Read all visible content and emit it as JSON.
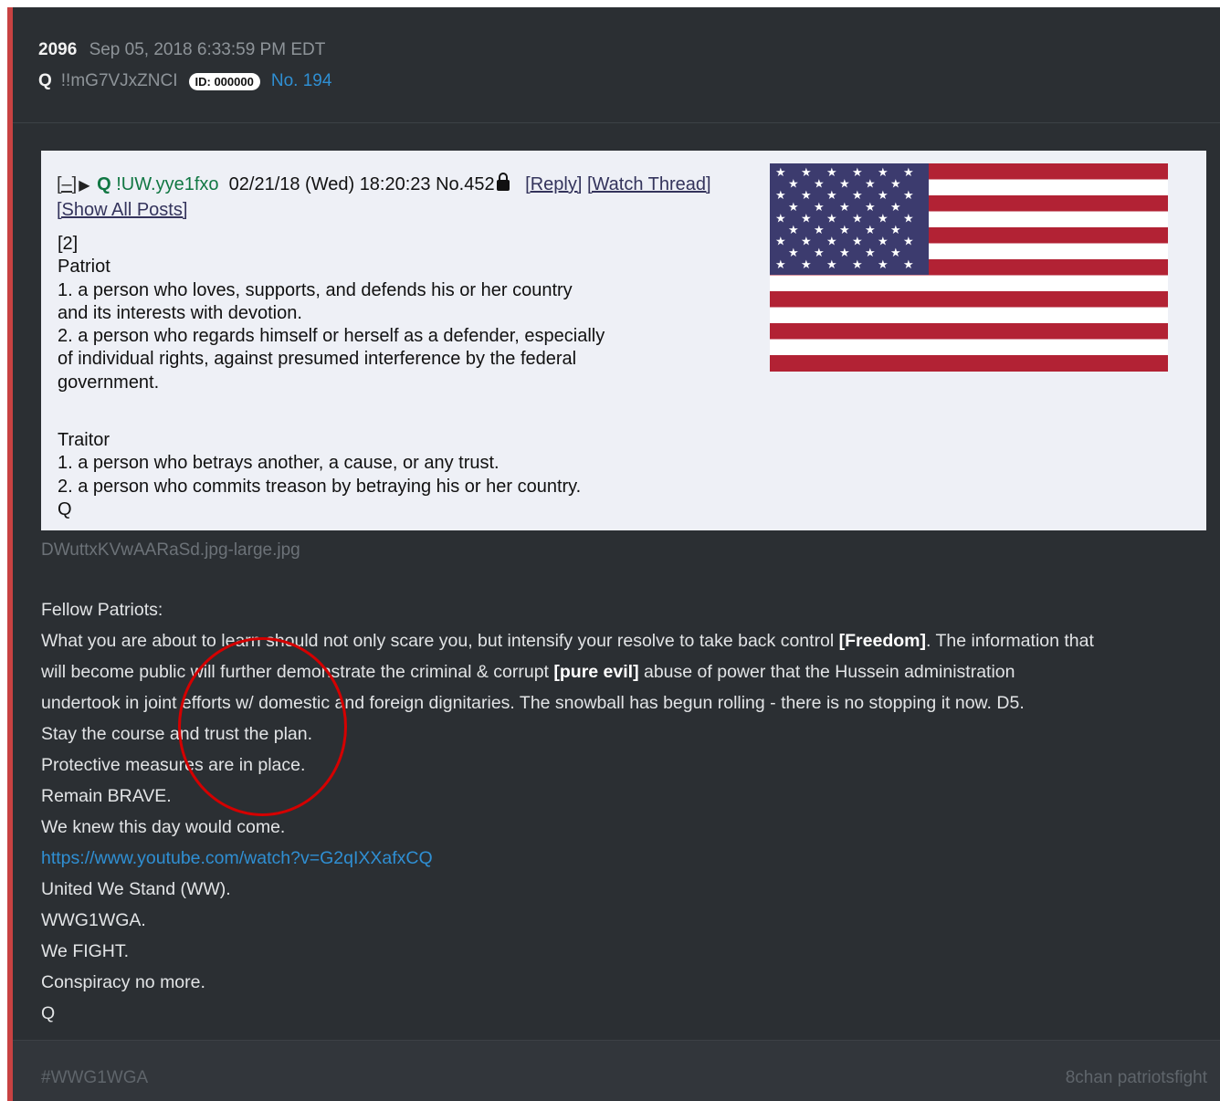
{
  "header": {
    "number": "2096",
    "date": "Sep 05, 2018 6:33:59 PM EDT",
    "author": "Q",
    "tripcode": "!!mG7VJxZNCI",
    "id_badge": "ID: 000000",
    "post_no": "No. 194"
  },
  "embedded_post": {
    "collapse": "[–]",
    "name": "Q",
    "tripcode": "!UW.yye1fxo",
    "datetime": "02/21/18 (Wed) 18:20:23",
    "post_no": "No.452",
    "links": [
      "[Reply]",
      "[Watch Thread]",
      "[Show All Posts]"
    ],
    "lines": [
      "[2]",
      "Patriot",
      "1. a person who loves, supports, and defends his or her country",
      "and its interests with devotion.",
      "2. a person who regards himself or herself as a defender, especially",
      "of individual rights, against presumed interference by the federal",
      "government.",
      "",
      "Traitor",
      "1. a person who betrays another, a cause, or any trust.",
      "2. a person who commits treason by betraying his or her country.",
      "Q"
    ]
  },
  "image_filename": "DWuttxKVwAARaSd.jpg-large.jpg",
  "body": {
    "greeting": "Fellow Patriots:",
    "p1_a": "What you are about to learn should not only scare you, but intensify your resolve to take back control ",
    "p1_bold1": "[Freedom]",
    "p1_b": ". The information that",
    "p2_a": "will become public will further demonstrate the criminal & corrupt ",
    "p2_bold2": "[pure evil]",
    "p2_b": " abuse of power that the Hussein administration",
    "p3": "undertook in joint efforts w/ domestic and foreign dignitaries. The snowball has begun rolling - there is no stopping it now. D5.",
    "lines_before_link": [
      "Stay the course and trust the plan.",
      "Protective measures are in place.",
      "Remain BRAVE.",
      "We knew this day would come."
    ],
    "link": "https://www.youtube.com/watch?v=G2qIXXafxCQ",
    "lines_after_link": [
      "United We Stand (WW).",
      "WWG1WGA.",
      "We FIGHT.",
      "Conspiracy no more.",
      "Q"
    ]
  },
  "footer": {
    "hashtag": "#WWG1WGA",
    "source": "8chan patriotsfight"
  },
  "colors": {
    "card_bg": "#2b2f33",
    "accent_bar": "#c84242",
    "link_blue": "#2f8fd3",
    "annotation_circle": "#d40000"
  }
}
